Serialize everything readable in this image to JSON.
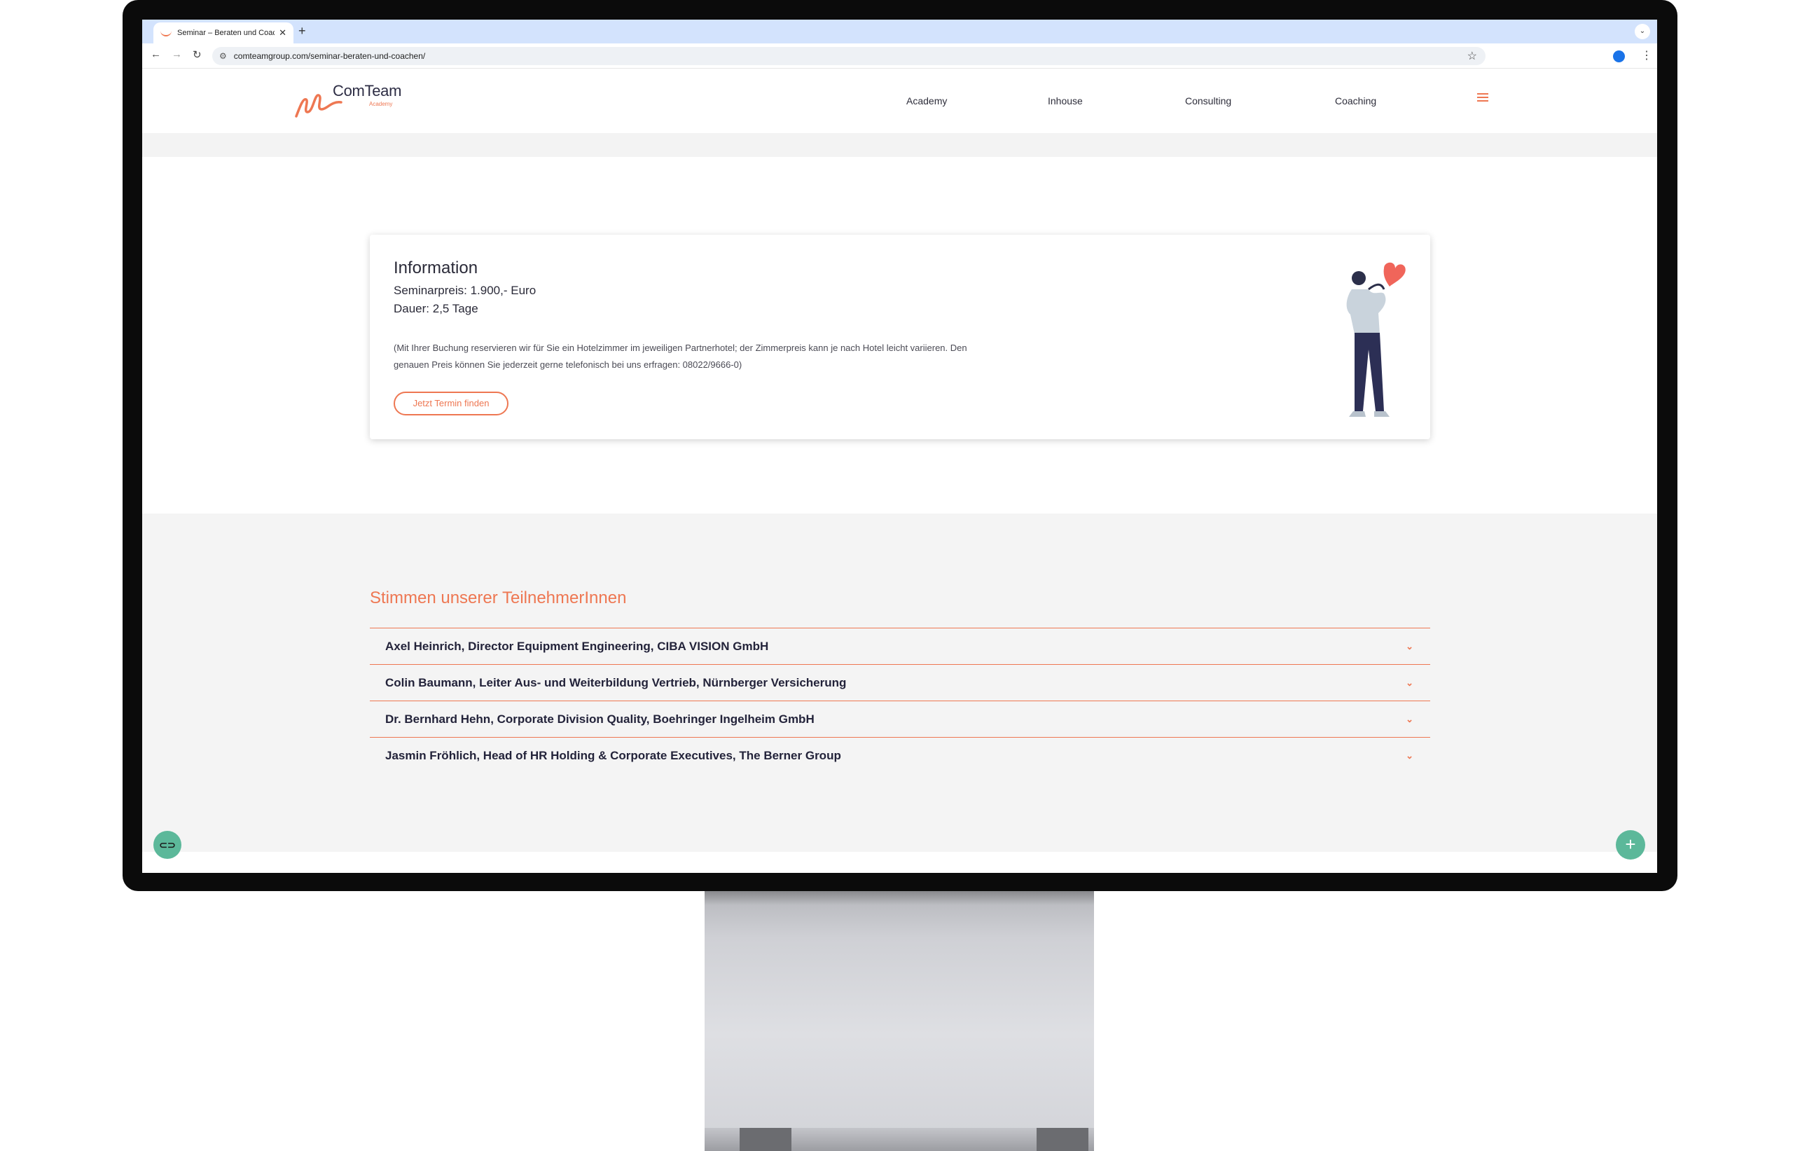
{
  "browser": {
    "tab_title": "Seminar – Beraten und Coaching",
    "url": "comteamgroup.com/seminar-beraten-und-coachen/"
  },
  "site": {
    "logo_text": "ComTeam",
    "logo_sub": "Academy",
    "nav": [
      "Academy",
      "Inhouse",
      "Consulting",
      "Coaching"
    ]
  },
  "info": {
    "title": "Information",
    "price": "Seminarpreis: 1.900,- Euro",
    "duration": "Dauer: 2,5 Tage",
    "note": "(Mit Ihrer Buchung reservieren wir für Sie ein Hotelzimmer im jeweiligen Partnerhotel; der Zimmerpreis kann je nach Hotel leicht variieren. Den genauen Preis können Sie jederzeit gerne telefonisch bei uns erfragen: 08022/9666-0)",
    "cta": "Jetzt Termin finden"
  },
  "testimonials": {
    "title": "Stimmen unserer TeilnehmerInnen",
    "items": [
      "Axel Heinrich, Director Equipment Engineering, CIBA VISION GmbH",
      "Colin Baumann, Leiter Aus- und Weiterbildung Vertrieb, Nürnberger Versicherung",
      "Dr. Bernhard Hehn, Corporate Division Quality, Boehringer Ingelheim GmbH",
      "Jasmin Fröhlich, Head of HR Holding & Corporate Executives, The Berner Group"
    ]
  },
  "colors": {
    "accent": "#ee7752",
    "fab": "#5cb89a",
    "text_dark": "#23233a"
  }
}
